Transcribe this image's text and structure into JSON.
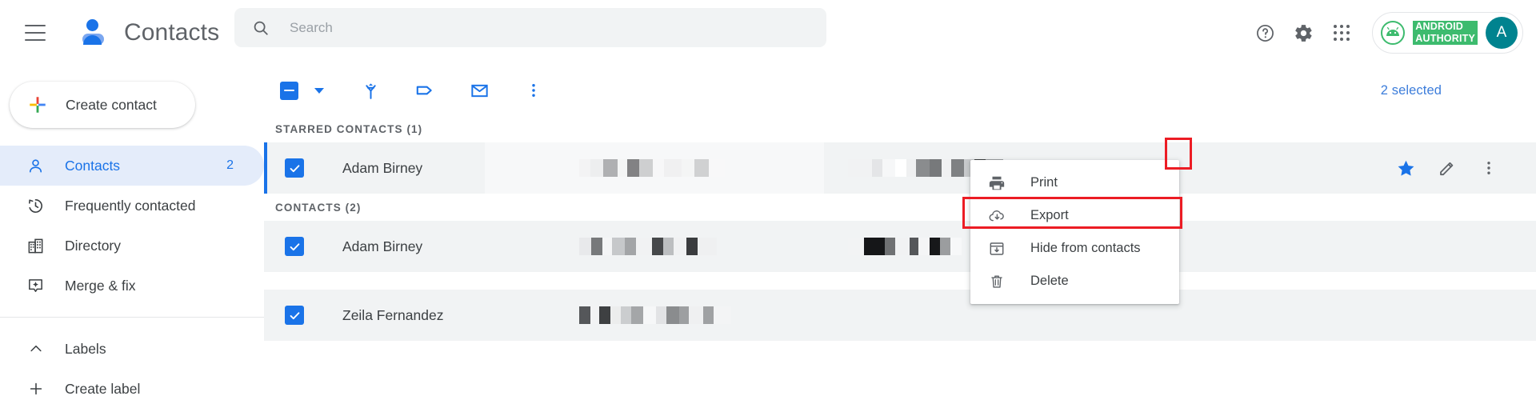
{
  "app": {
    "title": "Contacts",
    "menu_icon": "hamburger-icon",
    "logo_icon": "contacts-person-logo"
  },
  "search": {
    "placeholder": "Search",
    "value": "",
    "icon": "search-icon"
  },
  "header_actions": [
    {
      "name": "help-icon",
      "label": "Help"
    },
    {
      "name": "gear-icon",
      "label": "Settings"
    },
    {
      "name": "apps-grid-icon",
      "label": "Google apps"
    }
  ],
  "account": {
    "brand_line1": "ANDROID",
    "brand_line2": "AUTHORITY",
    "brand_color": "#3dbb6e",
    "avatar_letter": "A",
    "avatar_color": "#00838f"
  },
  "sidebar": {
    "create_contact": {
      "label": "Create contact",
      "icon": "plus-icon"
    },
    "items": [
      {
        "label": "Contacts",
        "icon": "person-icon",
        "count": "2",
        "active": true
      },
      {
        "label": "Frequently contacted",
        "icon": "history-icon",
        "count": "",
        "active": false
      },
      {
        "label": "Directory",
        "icon": "building-icon",
        "count": "",
        "active": false
      },
      {
        "label": "Merge & fix",
        "icon": "merge-fix-icon",
        "count": "",
        "active": false
      }
    ],
    "labels_section": {
      "label": "Labels",
      "icon": "chevron-up-icon"
    },
    "create_label": {
      "label": "Create label",
      "icon": "plus-icon"
    }
  },
  "toolbar": {
    "select_all": {
      "icon": "indeterminate-checkbox-icon",
      "caret": "chevron-down-icon"
    },
    "actions": [
      {
        "name": "merge-icon",
        "label": "Merge"
      },
      {
        "name": "label-icon",
        "label": "Manage labels"
      },
      {
        "name": "email-icon",
        "label": "Send email"
      },
      {
        "name": "more-vert-icon",
        "label": "More actions"
      }
    ],
    "selected_text": "2 selected",
    "selected_color": "#3c7ddb"
  },
  "list": {
    "sections": [
      {
        "heading": "STARRED CONTACTS (1)",
        "rows": [
          {
            "name": "Adam Birney",
            "checked": true,
            "starred": true,
            "accent": true,
            "email_redacted": true,
            "phone_redacted": true,
            "actions": [
              "star-icon",
              "edit-pencil-icon",
              "more-vert-icon"
            ]
          }
        ]
      },
      {
        "heading": "CONTACTS (2)",
        "rows": [
          {
            "name": "Adam Birney",
            "checked": true,
            "starred": false,
            "accent": false,
            "email_redacted": true,
            "phone_redacted": true,
            "actions": []
          },
          {
            "name": "Zeila Fernandez",
            "checked": true,
            "starred": false,
            "accent": false,
            "email_redacted": true,
            "phone_redacted": true,
            "actions": []
          }
        ]
      }
    ]
  },
  "context_menu": {
    "items": [
      {
        "label": "Print",
        "icon": "printer-icon",
        "highlighted": false
      },
      {
        "label": "Export",
        "icon": "cloud-download-icon",
        "highlighted": true
      },
      {
        "label": "Hide from contacts",
        "icon": "archive-icon",
        "highlighted": false
      },
      {
        "label": "Delete",
        "icon": "trash-icon",
        "highlighted": false
      }
    ]
  },
  "highlights": {
    "color": "#ec1c24",
    "boxes": [
      "export-menu-item",
      "row-more-vert-button"
    ]
  }
}
